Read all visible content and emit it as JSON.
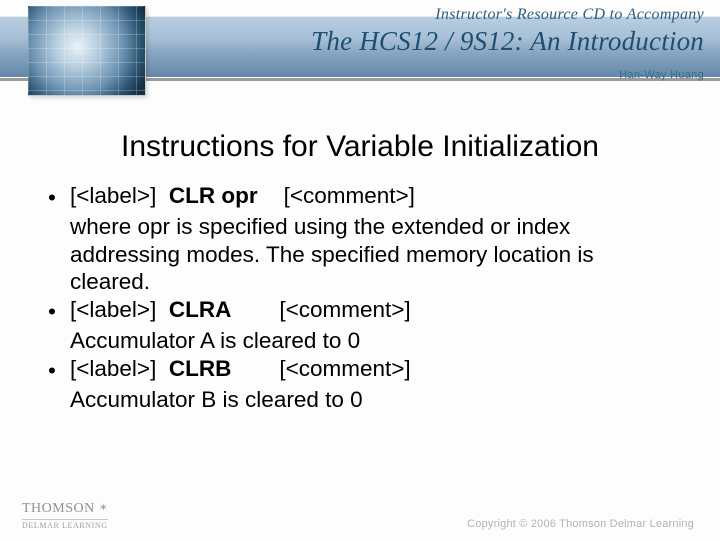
{
  "header": {
    "small": "Instructor's Resource CD to Accompany",
    "title": "The HCS12 / 9S12: An Introduction",
    "author": "Han-Way Huang"
  },
  "slide": {
    "title": "Instructions for Variable Initialization"
  },
  "bullets": [
    {
      "label": "[<label>]",
      "mnemonic": "CLR opr",
      "comment": "[<comment>]",
      "desc": "where opr is specified using the extended or index addressing modes. The specified memory location is cleared."
    },
    {
      "label": "[<label>]",
      "mnemonic": "CLRA",
      "comment": "[<comment>]",
      "desc": "Accumulator A is cleared to 0"
    },
    {
      "label": "[<label>]",
      "mnemonic": "CLRB",
      "comment": "[<comment>]",
      "desc": "Accumulator B is cleared to 0"
    }
  ],
  "footer": {
    "publisher_top": "THOMSON",
    "publisher_bottom": "DELMAR LEARNING",
    "copyright": "Copyright © 2006 Thomson Delmar Learning"
  }
}
